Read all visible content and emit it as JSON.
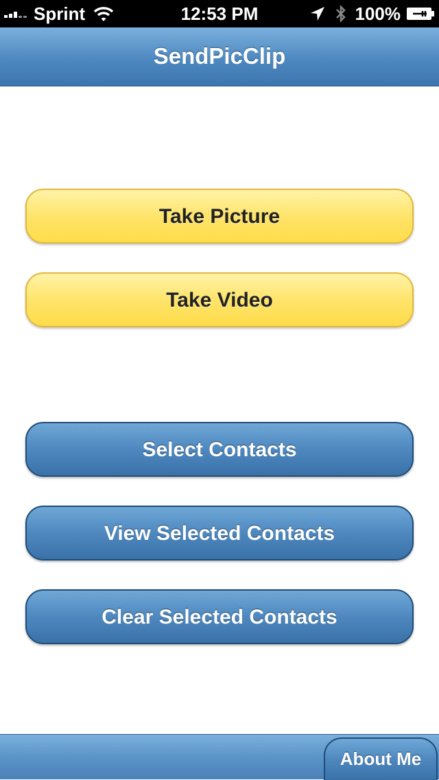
{
  "status_bar": {
    "carrier": "Sprint",
    "time": "12:53 PM",
    "battery": "100%",
    "icons": [
      "signal-bars-icon",
      "wifi-icon",
      "location-arrow-icon",
      "bluetooth-icon",
      "battery-charging-icon"
    ]
  },
  "nav": {
    "title": "SendPicClip"
  },
  "buttons": {
    "take_picture": "Take Picture",
    "take_video": "Take Video",
    "select_contacts": "Select Contacts",
    "view_selected": "View Selected Contacts",
    "clear_selected": "Clear Selected Contacts"
  },
  "footer": {
    "about": "About Me"
  },
  "colors": {
    "yellow_button": "#ffe46b",
    "blue_button": "#4e88bf",
    "nav_bar": "#4e88c0"
  }
}
